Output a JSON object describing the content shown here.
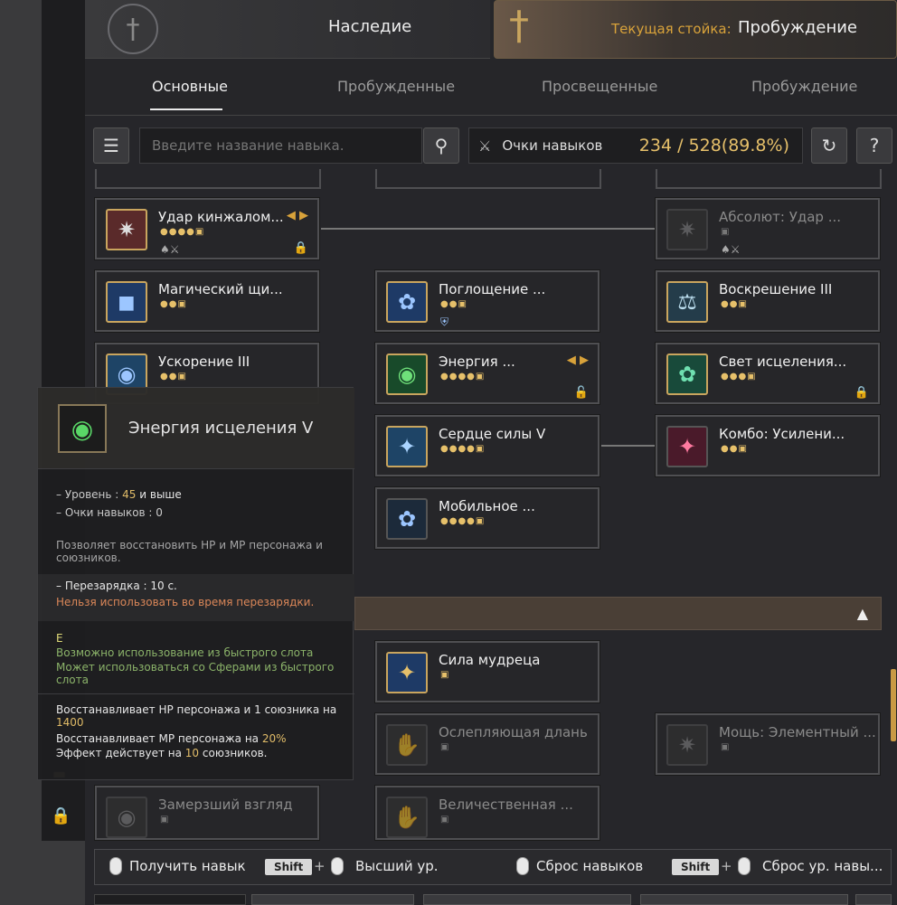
{
  "header": {
    "title": "Наследие",
    "stance_label": "Текущая стойка:",
    "stance_value": "Пробуждение"
  },
  "tabs": [
    {
      "label": "Основные"
    },
    {
      "label": "Пробужденные"
    },
    {
      "label": "Просвещенные"
    },
    {
      "label": "Пробуждение"
    }
  ],
  "search": {
    "placeholder": "Введите название навыка."
  },
  "points": {
    "label": "Очки навыков",
    "value": "234 / 528(89.8%)"
  },
  "skills": [
    {
      "name": "Удар кинжалом..."
    },
    {
      "name": "Абсолют: Удар ..."
    },
    {
      "name": "Магический щи..."
    },
    {
      "name": "Поглощение ..."
    },
    {
      "name": "Воскрешение III"
    },
    {
      "name": "Ускорение III"
    },
    {
      "name": "Энергия ..."
    },
    {
      "name": "Свет исцеления..."
    },
    {
      "name": "Сердце силы V"
    },
    {
      "name": "Комбо: Усилени..."
    },
    {
      "name": "Мобильное ..."
    },
    {
      "name": "Сила мудреца"
    },
    {
      "name": "Ослепляющая длань"
    },
    {
      "name": "Мощь: Элементный ..."
    },
    {
      "name": "Замерзший взгляд"
    },
    {
      "name": "Величественная ..."
    }
  ],
  "tooltip": {
    "name": "Энергия исцеления V",
    "level_label": "– Уровень :",
    "level_value": "45",
    "level_suffix": "и выше",
    "points_line": "– Очки навыков : 0",
    "desc": "Позволяет восстановить HP и MP персонажа и союзников.",
    "cooldown": "– Перезарядка              : 10 с.",
    "cooldown_warn": "Нельзя использовать во время перезарядки.",
    "key": "E",
    "slot1": "Возможно использование из быстрого слота",
    "slot2": "Может использоваться со Сферами из быстрого слота",
    "eff1": "Восстанавливает HP персонажа и 1 союзника на",
    "eff1_val": "1400",
    "eff2": "Восстанавливает MP персонажа на",
    "eff2_val": "20%",
    "eff3_a": "Эффект действует на",
    "eff3_val": "10",
    "eff3_b": "союзников."
  },
  "bottom": {
    "get_skill": "Получить навык",
    "shift": "Shift",
    "plus": "+",
    "max_level": "Высший ур.",
    "reset": "Сброс навыков",
    "reset_level": "Сброс ур. навы..."
  }
}
